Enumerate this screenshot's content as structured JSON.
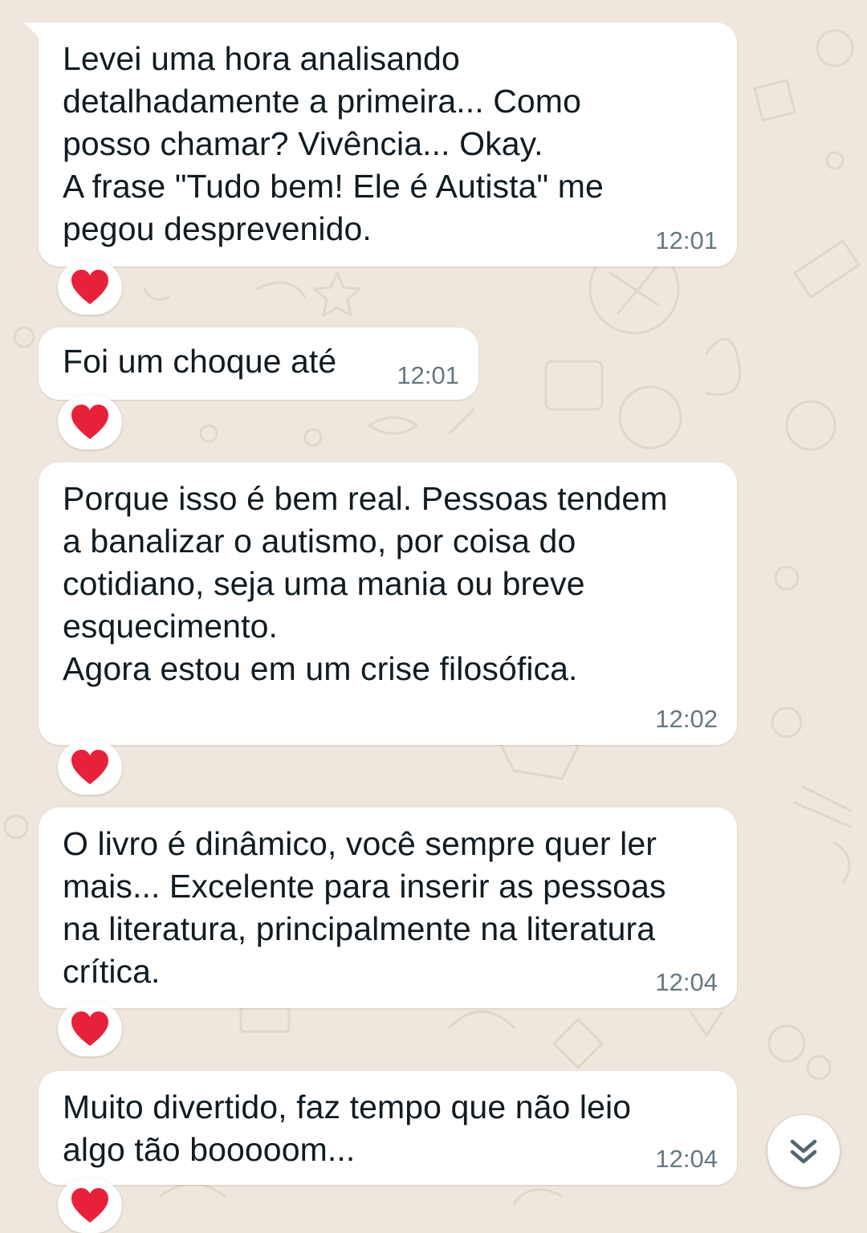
{
  "chat": {
    "messages": [
      {
        "text": "Levei uma hora analisando\ndetalhadamente a primeira... Como\nposso chamar? Vivência... Okay.\nA frase \"Tudo bem! Ele é Autista\" me\npegou desprevenido.",
        "time": "12:01",
        "reaction": "red-heart"
      },
      {
        "text": "Foi um choque até",
        "time": "12:01",
        "reaction": "red-heart"
      },
      {
        "text": "Porque isso é bem real. Pessoas tendem\na banalizar o autismo, por coisa do\ncotidiano, seja uma mania ou breve\nesquecimento.\nAgora estou em um crise filosófica.",
        "time": "12:02",
        "reaction": "red-heart"
      },
      {
        "text": "O livro é dinâmico, você sempre quer ler\nmais... Excelente para inserir as pessoas\nna literatura, principalmente na literatura\ncrítica.",
        "time": "12:04",
        "reaction": "red-heart"
      },
      {
        "text": "Muito divertido, faz tempo que não leio\nalgo tão booooom...",
        "time": "12:04",
        "reaction": "red-heart"
      }
    ]
  },
  "scroll_button": {
    "icon": "double-chevron-down-icon"
  },
  "colors": {
    "background": "#efe7dd",
    "bubble": "#ffffff",
    "text": "#111b21",
    "time": "#667781",
    "heart": "#e8213a"
  }
}
